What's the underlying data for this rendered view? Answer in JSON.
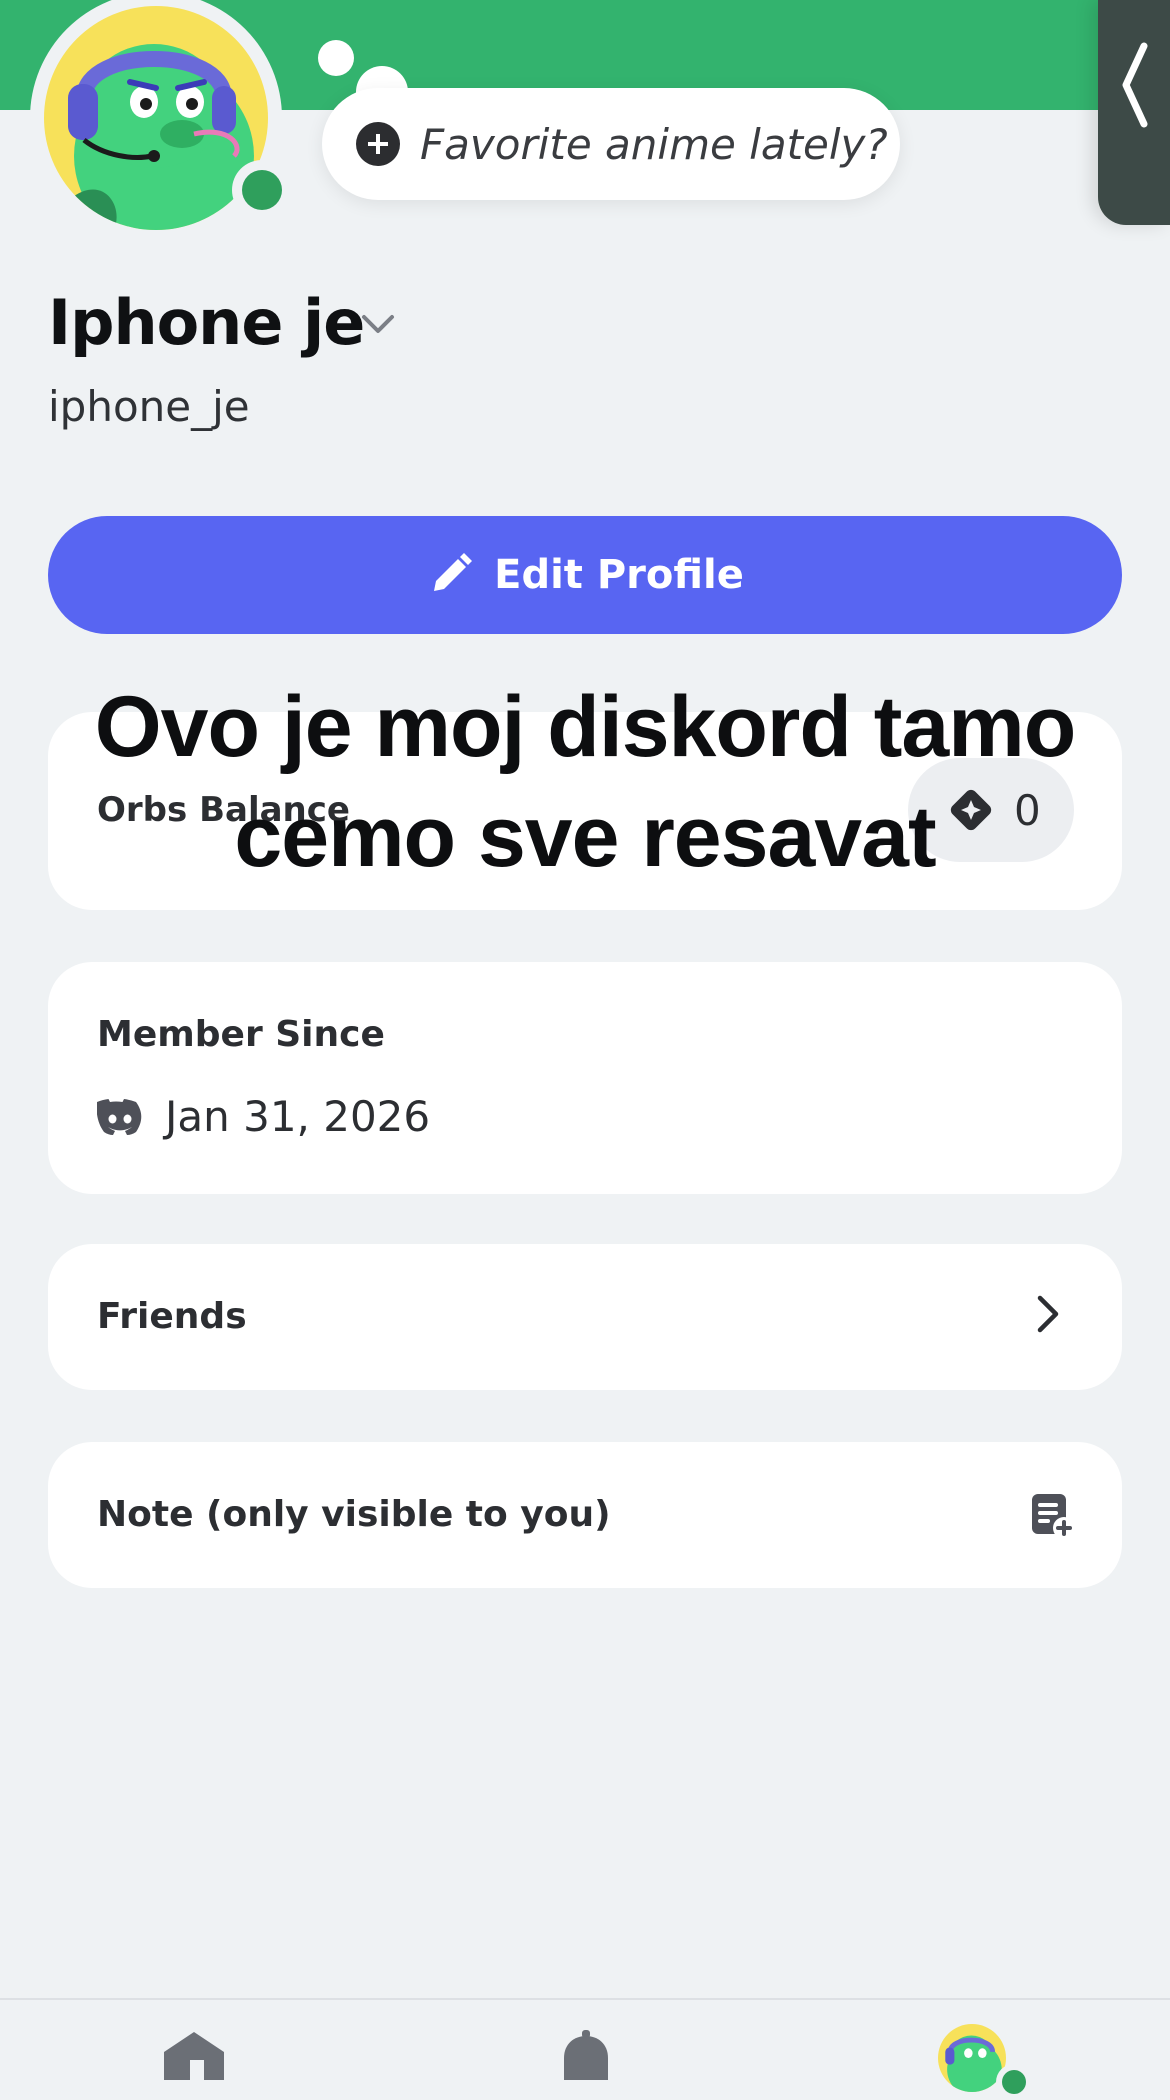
{
  "profile": {
    "display_name": "Iphone je",
    "username": "iphone_je",
    "status_prompt": "Favorite anime lately?",
    "edit_profile_label": "Edit Profile"
  },
  "orbs": {
    "label": "Orbs Balance",
    "value": "0"
  },
  "member_since": {
    "label": "Member Since",
    "date": "Jan 31, 2026"
  },
  "friends": {
    "label": "Friends"
  },
  "note": {
    "label": "Note (only visible to you)"
  },
  "overlay_caption": {
    "line1": "Ovo je moj diskord tamo",
    "line2": "cemo sve resavat"
  },
  "nav": {
    "items": [
      "home-icon",
      "bell-icon",
      "profile-avatar"
    ]
  },
  "colors": {
    "banner": "#33b36e",
    "accent": "#5865f2",
    "online": "#2f9f5c",
    "background": "#eff2f4"
  }
}
